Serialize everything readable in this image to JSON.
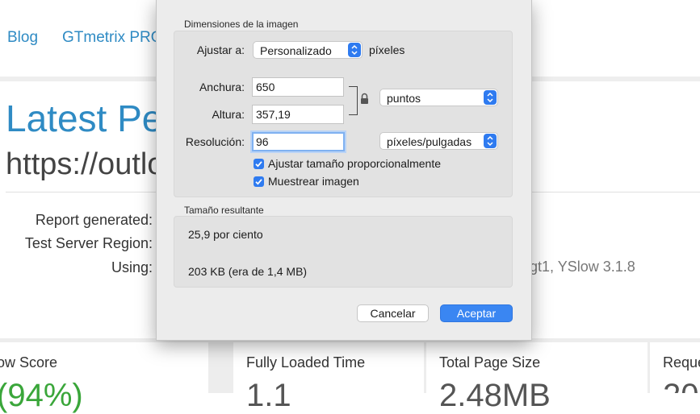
{
  "background_page": {
    "nav_links": [
      "Blog",
      "GTmetrix PRO"
    ],
    "headline": "Latest Pe",
    "url_fragment": "https://outlo",
    "report_labels": [
      "Report generated:",
      "Test Server Region:",
      "Using:"
    ],
    "using_value_fragment": "gt1, YSlow 3.1.8",
    "cards": [
      {
        "title": "ow Score",
        "big": "(94%)"
      },
      {
        "title": "Fully Loaded Time",
        "big": "1.1"
      },
      {
        "title": "Total Page Size",
        "big": "2.48MB"
      },
      {
        "title": "Reque",
        "big": "20"
      }
    ],
    "colors": {
      "link": "#2f8bc4",
      "score": "#3aa63a"
    }
  },
  "dialog": {
    "section_dimensions": "Dimensiones de la imagen",
    "fit_label": "Ajustar a:",
    "fit_value": "Personalizado",
    "fit_units": "píxeles",
    "width_label": "Anchura:",
    "width_value": "650",
    "height_label": "Altura:",
    "height_value": "357,19",
    "size_units_value": "puntos",
    "resolution_label": "Resolución:",
    "resolution_value": "96",
    "resolution_units_value": "píxeles/pulgadas",
    "scale_proportionally_label": "Ajustar tamaño proporcionalmente",
    "scale_proportionally_checked": true,
    "resample_label": "Muestrear imagen",
    "resample_checked": true,
    "section_result": "Tamaño resultante",
    "result_percent": "25,9 por ciento",
    "result_size": "203 KB (era de 1,4 MB)",
    "cancel_label": "Cancelar",
    "accept_label": "Aceptar",
    "colors": {
      "accent": "#2f7bf0"
    },
    "icons": {
      "lock": "lock-icon",
      "stepper": "chevron-updown-icon",
      "check": "checkmark-icon"
    }
  }
}
